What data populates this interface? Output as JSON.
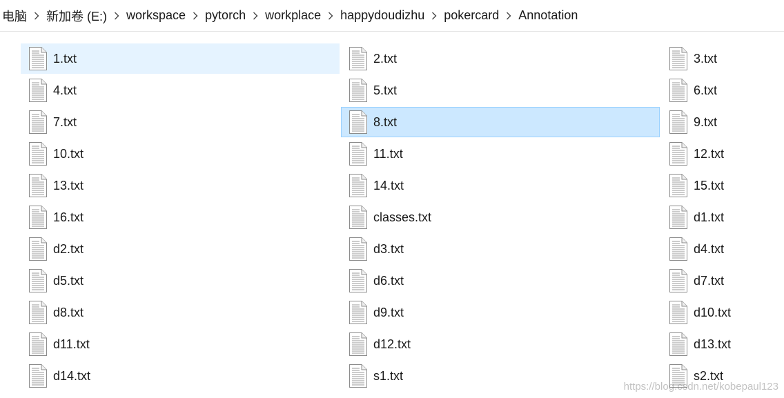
{
  "breadcrumb": {
    "items": [
      {
        "label": "电脑"
      },
      {
        "label": "新加卷 (E:)"
      },
      {
        "label": "workspace"
      },
      {
        "label": "pytorch"
      },
      {
        "label": "workplace"
      },
      {
        "label": "happydoudizhu"
      },
      {
        "label": "pokercard"
      },
      {
        "label": "Annotation"
      }
    ],
    "separator_icon": "chevron-right-icon"
  },
  "files": [
    {
      "name": "1.txt",
      "state": "hover",
      "icon": "text-file-icon"
    },
    {
      "name": "2.txt",
      "state": "",
      "icon": "text-file-icon"
    },
    {
      "name": "3.txt",
      "state": "",
      "icon": "text-file-icon"
    },
    {
      "name": "4.txt",
      "state": "",
      "icon": "text-file-icon"
    },
    {
      "name": "5.txt",
      "state": "",
      "icon": "text-file-icon"
    },
    {
      "name": "6.txt",
      "state": "",
      "icon": "text-file-icon"
    },
    {
      "name": "7.txt",
      "state": "",
      "icon": "text-file-icon"
    },
    {
      "name": "8.txt",
      "state": "selected",
      "icon": "text-file-icon"
    },
    {
      "name": "9.txt",
      "state": "",
      "icon": "text-file-icon"
    },
    {
      "name": "10.txt",
      "state": "",
      "icon": "text-file-icon"
    },
    {
      "name": "11.txt",
      "state": "",
      "icon": "text-file-icon"
    },
    {
      "name": "12.txt",
      "state": "",
      "icon": "text-file-icon"
    },
    {
      "name": "13.txt",
      "state": "",
      "icon": "text-file-icon"
    },
    {
      "name": "14.txt",
      "state": "",
      "icon": "text-file-icon"
    },
    {
      "name": "15.txt",
      "state": "",
      "icon": "text-file-icon"
    },
    {
      "name": "16.txt",
      "state": "",
      "icon": "text-file-icon"
    },
    {
      "name": "classes.txt",
      "state": "",
      "icon": "text-file-icon"
    },
    {
      "name": "d1.txt",
      "state": "",
      "icon": "text-file-icon"
    },
    {
      "name": "d2.txt",
      "state": "",
      "icon": "text-file-icon"
    },
    {
      "name": "d3.txt",
      "state": "",
      "icon": "text-file-icon"
    },
    {
      "name": "d4.txt",
      "state": "",
      "icon": "text-file-icon"
    },
    {
      "name": "d5.txt",
      "state": "",
      "icon": "text-file-icon"
    },
    {
      "name": "d6.txt",
      "state": "",
      "icon": "text-file-icon"
    },
    {
      "name": "d7.txt",
      "state": "",
      "icon": "text-file-icon"
    },
    {
      "name": "d8.txt",
      "state": "",
      "icon": "text-file-icon"
    },
    {
      "name": "d9.txt",
      "state": "",
      "icon": "text-file-icon"
    },
    {
      "name": "d10.txt",
      "state": "",
      "icon": "text-file-icon"
    },
    {
      "name": "d11.txt",
      "state": "",
      "icon": "text-file-icon"
    },
    {
      "name": "d12.txt",
      "state": "",
      "icon": "text-file-icon"
    },
    {
      "name": "d13.txt",
      "state": "",
      "icon": "text-file-icon"
    },
    {
      "name": "d14.txt",
      "state": "",
      "icon": "text-file-icon"
    },
    {
      "name": "s1.txt",
      "state": "",
      "icon": "text-file-icon"
    },
    {
      "name": "s2.txt",
      "state": "",
      "icon": "text-file-icon"
    }
  ],
  "watermark": "https://blog.csdn.net/kobepaul123",
  "colors": {
    "hover_bg": "#e5f3ff",
    "selected_bg": "#cce8ff",
    "selected_border": "#99d1ff",
    "text": "#1a1a1a"
  }
}
